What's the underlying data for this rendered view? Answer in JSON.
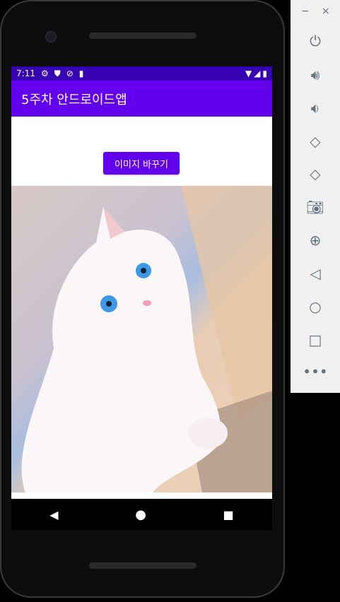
{
  "status_bar": {
    "time": "7:11",
    "icons": [
      "settings-icon",
      "shield-icon",
      "no-sync-icon",
      "sd-card-icon"
    ],
    "right_icons": [
      "wifi-icon",
      "signal-icon",
      "battery-icon"
    ]
  },
  "app_bar": {
    "title": "5주차 안드로이드앱"
  },
  "main": {
    "button_label": "이미지 바꾸기",
    "image": "white-cat-photo"
  },
  "nav_bar": [
    "back",
    "home",
    "recents"
  ],
  "emulator_toolbar": {
    "items": [
      "power",
      "volume-up",
      "volume-down",
      "rotate-left",
      "rotate-right",
      "screenshot",
      "zoom",
      "back",
      "home",
      "overview",
      "more"
    ]
  },
  "colors": {
    "primary": "#6200EE",
    "primary_dark": "#3700B3"
  }
}
